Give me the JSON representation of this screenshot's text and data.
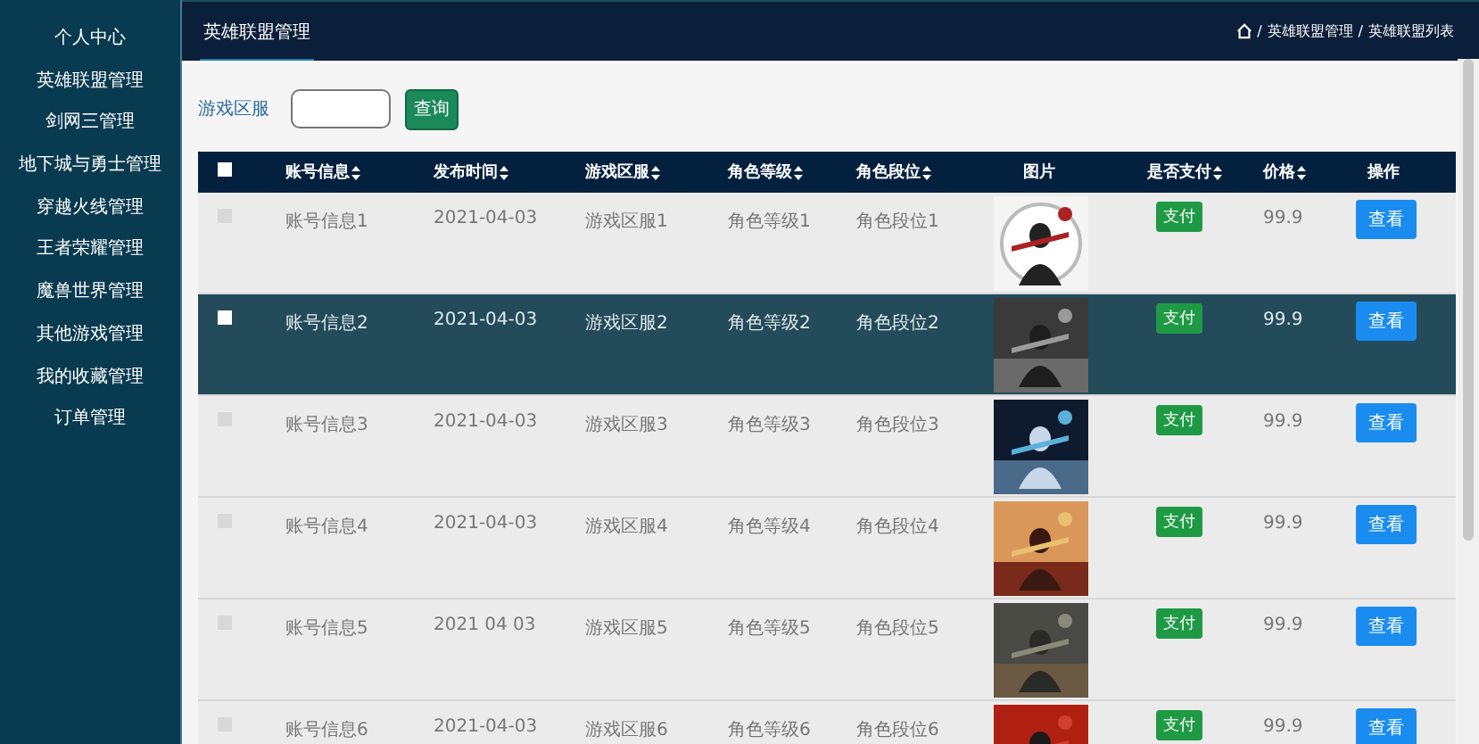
{
  "sidebar": {
    "items": [
      {
        "label": "个人中心"
      },
      {
        "label": "英雄联盟管理"
      },
      {
        "label": "剑网三管理"
      },
      {
        "label": "地下城与勇士管理"
      },
      {
        "label": "穿越火线管理"
      },
      {
        "label": "王者荣耀管理"
      },
      {
        "label": "魔兽世界管理"
      },
      {
        "label": "其他游戏管理"
      },
      {
        "label": "我的收藏管理"
      },
      {
        "label": "订单管理"
      }
    ]
  },
  "tabs": [
    {
      "label": "英雄联盟管理",
      "selected": true
    }
  ],
  "breadcrumb": [
    {
      "sep": "/",
      "label": "英雄联盟管理"
    },
    {
      "sep": "/",
      "label": "英雄联盟列表"
    }
  ],
  "search": {
    "label": "游戏区服",
    "button": "查询"
  },
  "table": {
    "select_all": {
      "checked": false
    },
    "columns": [
      {
        "label": "账号信息",
        "sortable": true
      },
      {
        "label": "发布时间",
        "sortable": true
      },
      {
        "label": "游戏区服",
        "sortable": true
      },
      {
        "label": "角色等级",
        "sortable": true
      },
      {
        "label": "角色段位",
        "sortable": true
      },
      {
        "label": "图片",
        "sortable": false
      },
      {
        "label": "是否支付",
        "sortable": true
      },
      {
        "label": "价格",
        "sortable": true
      },
      {
        "label": "操作",
        "sortable": false
      }
    ],
    "rows": [
      {
        "highlighted": false,
        "checked": false,
        "cells": [
          "账号信息1",
          "2021-04-03",
          "游戏区服1",
          "角色等级1",
          "角色段位1"
        ],
        "image": {
          "kind": "picture"
        },
        "pay": "支付",
        "price": "99.9",
        "action": "查看"
      },
      {
        "highlighted": true,
        "checked": false,
        "cells": [
          "账号信息2",
          "2021-04-03",
          "游戏区服2",
          "角色等级2",
          "角色段位2"
        ],
        "image": {
          "kind": "picture"
        },
        "pay": "支付",
        "price": "99.9",
        "action": "查看"
      },
      {
        "highlighted": false,
        "checked": false,
        "cells": [
          "账号信息3",
          "2021-04-03",
          "游戏区服3",
          "角色等级3",
          "角色段位3"
        ],
        "image": {
          "kind": "picture"
        },
        "pay": "支付",
        "price": "99.9",
        "action": "查看"
      },
      {
        "highlighted": false,
        "checked": false,
        "cells": [
          "账号信息4",
          "2021-04-03",
          "游戏区服4",
          "角色等级4",
          "角色段位4"
        ],
        "image": {
          "kind": "picture"
        },
        "pay": "支付",
        "price": "99.9",
        "action": "查看"
      },
      {
        "highlighted": false,
        "checked": false,
        "cells": [
          "账号信息5",
          "2021 04 03",
          "游戏区服5",
          "角色等级5",
          "角色段位5"
        ],
        "image": {
          "kind": "picture"
        },
        "pay": "支付",
        "price": "99.9",
        "action": "查看"
      },
      {
        "highlighted": false,
        "checked": false,
        "cells": [
          "账号信息6",
          "2021-04-03",
          "游戏区服6",
          "角色等级6",
          "角色段位6"
        ],
        "image": {
          "kind": "picture"
        },
        "pay": "支付",
        "price": "99.9",
        "action": "查看"
      }
    ]
  }
}
